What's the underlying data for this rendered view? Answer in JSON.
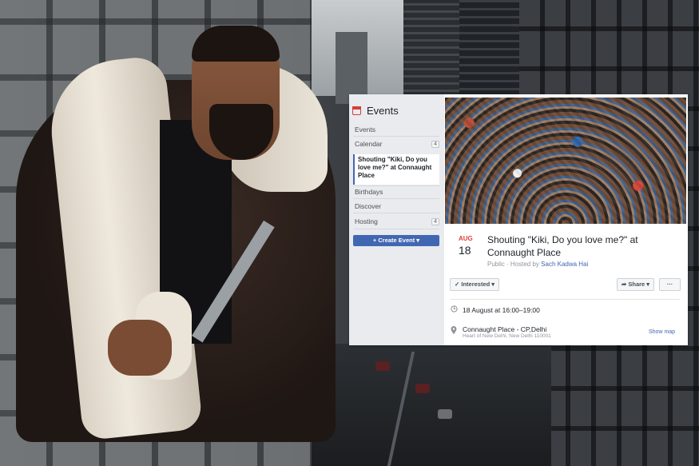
{
  "events_widget": {
    "header_title": "Events",
    "sidebar": {
      "items": [
        {
          "label": "Events",
          "count": ""
        },
        {
          "label": "Calendar",
          "count": "4"
        },
        {
          "label": "Birthdays",
          "count": ""
        },
        {
          "label": "Discover",
          "count": ""
        },
        {
          "label": "Hosting",
          "count": "4"
        }
      ],
      "selected_event": "Shouting \"Kiki, Do you love me?\" at Connaught Place",
      "create_button": "+ Create Event ▾"
    },
    "event": {
      "month": "AUG",
      "day": "18",
      "title": "Shouting \"Kiki, Do you love me?\" at Connaught Place",
      "privacy": "Public",
      "hosted_by_prefix": " · Hosted by ",
      "host": "Sach Kadwa Hai",
      "interested_button": "✓ Interested ▾",
      "share_button": "➦ Share ▾",
      "more_button": "···",
      "time": "18 August at 16:00–19:00",
      "location_name": "Connaught Place - CP,Delhi",
      "location_address": "Heart of New Delhi, New Delhi 110001",
      "show_map": "Show map",
      "time_icon": "clock-icon",
      "location_icon": "pin-icon"
    },
    "accent_color": "#4267b2",
    "date_color": "#e0443a"
  }
}
